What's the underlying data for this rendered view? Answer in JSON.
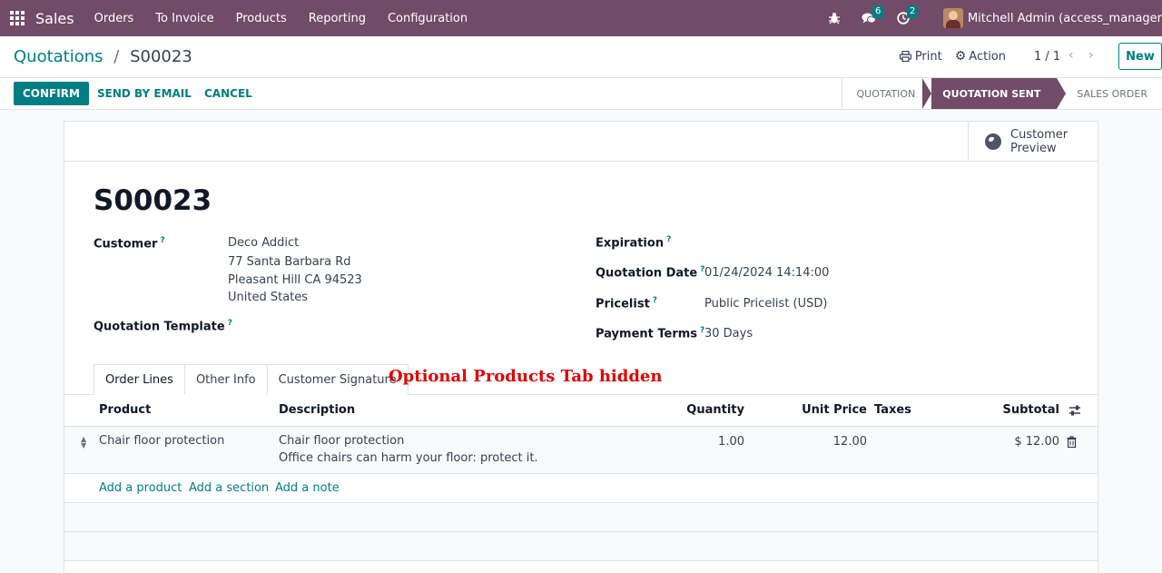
{
  "navbar": {
    "app_name": "Sales",
    "menu": [
      "Orders",
      "To Invoice",
      "Products",
      "Reporting",
      "Configuration"
    ],
    "messages_count": "6",
    "activities_count": "2",
    "user": "Mitchell Admin (access_manager"
  },
  "control_panel": {
    "breadcrumb_parent": "Quotations",
    "breadcrumb_separator": "/",
    "breadcrumb_current": "S00023",
    "print_label": "Print",
    "action_label": "Action",
    "pager": "1 / 1",
    "new_label": "New"
  },
  "statusbar": {
    "confirm_label": "CONFIRM",
    "send_email_label": "SEND BY EMAIL",
    "cancel_label": "CANCEL",
    "stages": [
      "QUOTATION",
      "QUOTATION SENT",
      "SALES ORDER"
    ],
    "active_stage": "QUOTATION SENT"
  },
  "form": {
    "preview_line1": "Customer",
    "preview_line2": "Preview",
    "title": "S00023",
    "customer_label": "Customer",
    "customer_name": "Deco Addict",
    "customer_address": [
      "77 Santa Barbara Rd",
      "Pleasant Hill CA 94523",
      "United States"
    ],
    "template_label": "Quotation Template",
    "expiration_label": "Expiration",
    "quotation_date_label": "Quotation Date",
    "quotation_date": "01/24/2024 14:14:00",
    "pricelist_label": "Pricelist",
    "pricelist": "Public Pricelist (USD)",
    "payment_terms_label": "Payment Terms",
    "payment_terms": "30 Days",
    "help_mark": "?"
  },
  "tabs": [
    "Order Lines",
    "Other Info",
    "Customer Signature"
  ],
  "annotation": "Optional Products Tab hidden",
  "order_table": {
    "headers": [
      "Product",
      "Description",
      "Quantity",
      "Unit Price",
      "Taxes",
      "Subtotal"
    ],
    "rows": [
      {
        "product": "Chair floor protection",
        "description": "Chair floor protection",
        "description_note": "Office chairs can harm your floor: protect it.",
        "quantity": "1.00",
        "unit_price": "12.00",
        "taxes": "",
        "subtotal": "$ 12.00"
      }
    ],
    "add_product": "Add a product",
    "add_section": "Add a section",
    "add_note": "Add a note"
  },
  "colors": {
    "brand": "#714B67",
    "accent": "#017e84",
    "annotation": "#e00000"
  },
  "icons": [
    "apps-icon",
    "bug-icon",
    "chat-icon",
    "clock-icon",
    "printer-icon",
    "gear-icon",
    "chevron-left-icon",
    "chevron-right-icon",
    "globe-icon",
    "drag-handle-icon",
    "trash-icon",
    "column-settings-icon"
  ]
}
